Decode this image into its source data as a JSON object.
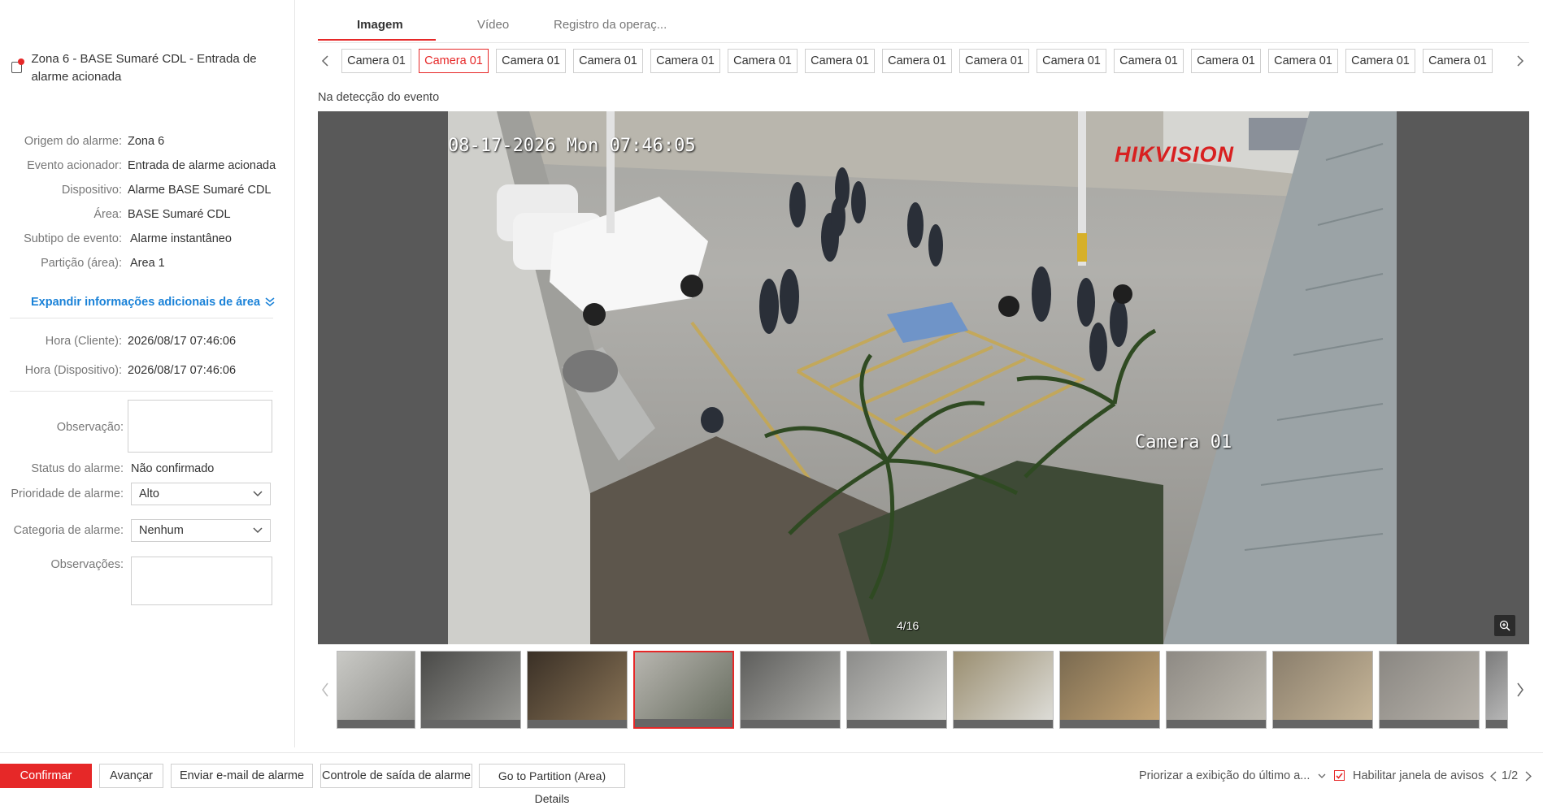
{
  "alarm": {
    "title": "Zona 6 - BASE Sumaré CDL - Entrada de alarme acionada"
  },
  "details": [
    {
      "label": "Origem do alarme:",
      "value": "Zona 6"
    },
    {
      "label": "Evento acionador:",
      "value": "Entrada de alarme acionada"
    },
    {
      "label": "Dispositivo:",
      "value": "Alarme BASE Sumaré CDL"
    },
    {
      "label": "Área:",
      "value": "BASE Sumaré CDL"
    },
    {
      "label": "Subtipo de evento:",
      "value": "Alarme instantâneo"
    },
    {
      "label": "Partição (área):",
      "value": "Area 1"
    }
  ],
  "expand_label": "Expandir informações adicionais de área",
  "times": [
    {
      "label": "Hora (Cliente):",
      "value": "2026/08/17 07:46:06"
    },
    {
      "label": "Hora (Dispositivo):",
      "value": "2026/08/17 07:46:06"
    }
  ],
  "form": {
    "observation_label": "Observação:",
    "observation_value": "",
    "status_label": "Status do alarme:",
    "status_value": "Não confirmado",
    "priority_label": "Prioridade de alarme:",
    "priority_value": "Alto",
    "category_label": "Categoria de alarme:",
    "category_value": "Nenhum",
    "remarks_label": "Observações:",
    "remarks_value": ""
  },
  "tabs": [
    "Imagem",
    "Vídeo",
    "Registro da operaç..."
  ],
  "active_tab": 0,
  "cameras": [
    "Camera 01",
    "Camera 01",
    "Camera 01",
    "Camera 01",
    "Camera 01",
    "Camera 01",
    "Camera 01",
    "Camera 01",
    "Camera 01",
    "Camera 01",
    "Camera 01",
    "Camera 01",
    "Camera 01",
    "Camera 01",
    "Camera 01"
  ],
  "active_camera": 1,
  "detection_label": "Na detecção do evento",
  "viewer": {
    "timestamp": "08-17-2026 Mon 07:46:05",
    "brand": "HIKVISION",
    "camera_name": "Camera 01",
    "counter": "4/16"
  },
  "thumbnails_active": 3,
  "footer": {
    "confirm": "Confirmar",
    "advance": "Avançar",
    "email": "Enviar e-mail de alarme",
    "output": "Controle de saída de alarme",
    "partition": "Go to Partition (Area) Details",
    "priority_display": "Priorizar a exibição do último a...",
    "enable_popup": "Habilitar janela de avisos",
    "page": "1/2"
  },
  "colors": {
    "accent": "#e62828",
    "link": "#1a82d8"
  }
}
